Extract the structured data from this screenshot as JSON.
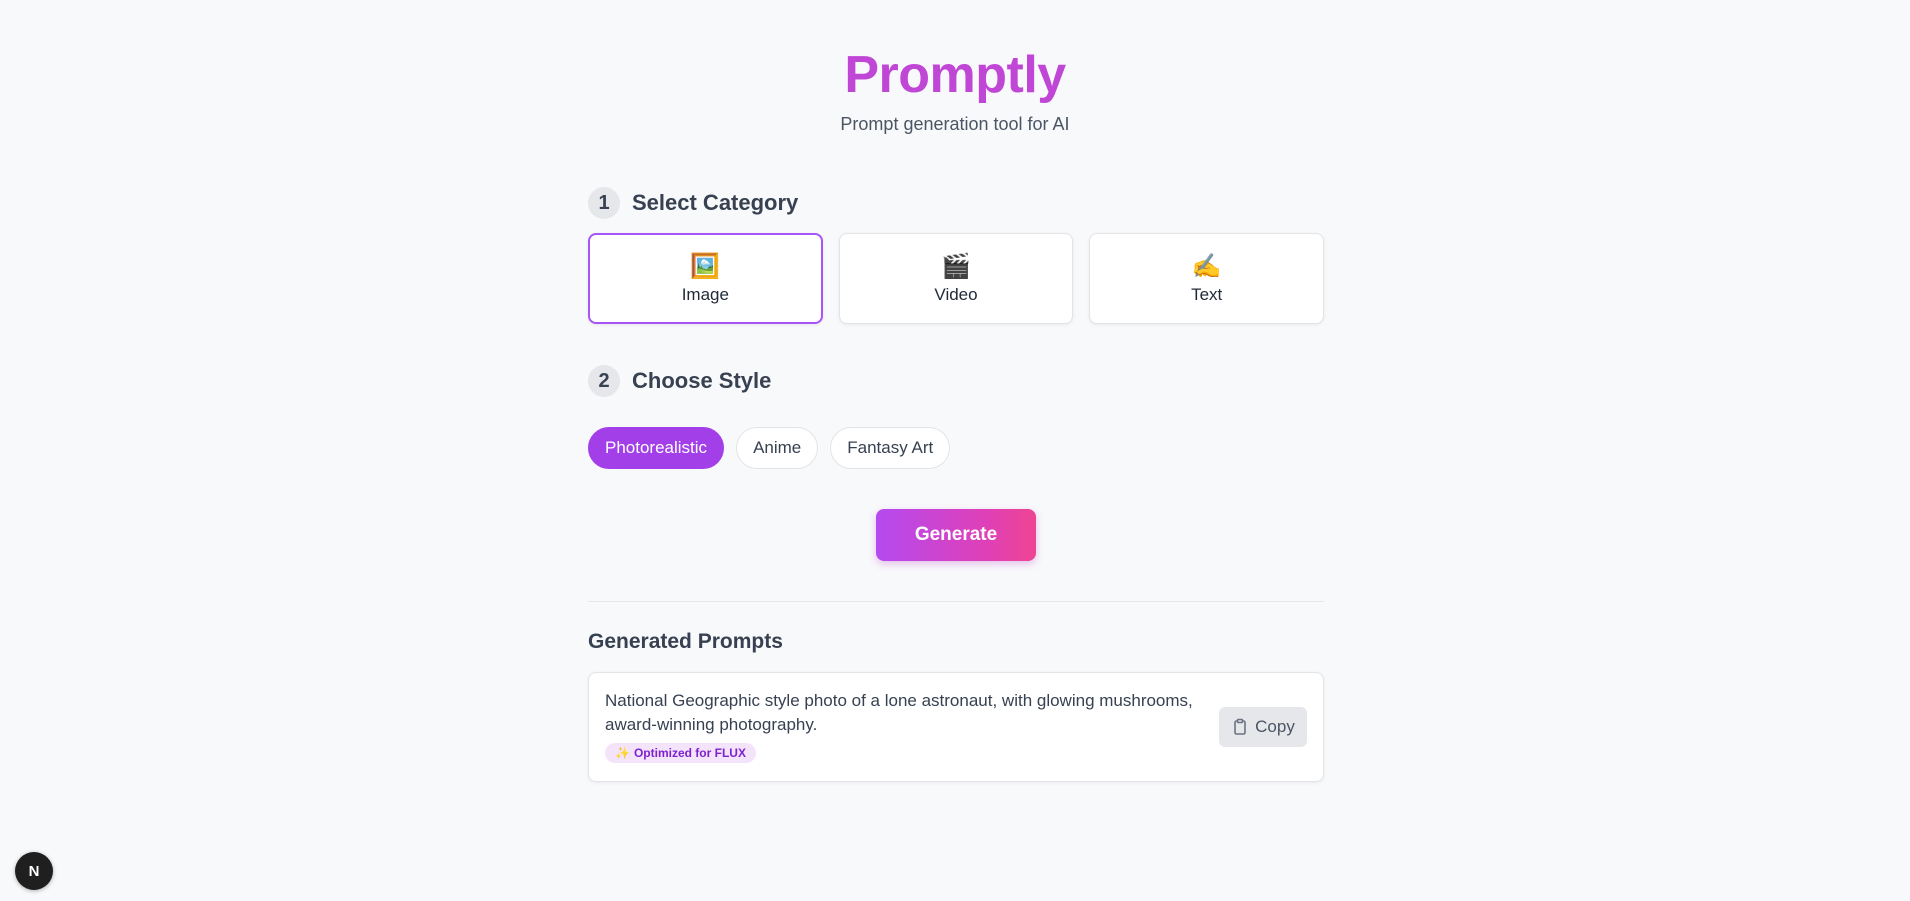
{
  "header": {
    "title": "Promptly",
    "subtitle": "Prompt generation tool for AI"
  },
  "step1": {
    "number": "1",
    "title": "Select Category",
    "categories": [
      {
        "icon": "🖼️",
        "icon_name": "framed-picture-icon",
        "label": "Image",
        "selected": true
      },
      {
        "icon": "🎬",
        "icon_name": "clapper-board-icon",
        "label": "Video",
        "selected": false
      },
      {
        "icon": "✍️",
        "icon_name": "writing-hand-icon",
        "label": "Text",
        "selected": false
      }
    ]
  },
  "step2": {
    "number": "2",
    "title": "Choose Style",
    "styles": [
      {
        "label": "Photorealistic",
        "active": true
      },
      {
        "label": "Anime",
        "active": false
      },
      {
        "label": "Fantasy Art",
        "active": false
      }
    ]
  },
  "generate": {
    "label": "Generate"
  },
  "results": {
    "title": "Generated Prompts",
    "prompts": [
      {
        "text": "National Geographic style photo of a lone astronaut, with glowing mushrooms, award-winning photography.",
        "badge_icon": "✨",
        "badge": "Optimized for FLUX",
        "copy_label": "Copy"
      }
    ]
  },
  "corner_badge": {
    "label": "N"
  },
  "colors": {
    "accent": "#a855f7",
    "title": "#c046d6",
    "gradient_end": "#ee4592"
  }
}
